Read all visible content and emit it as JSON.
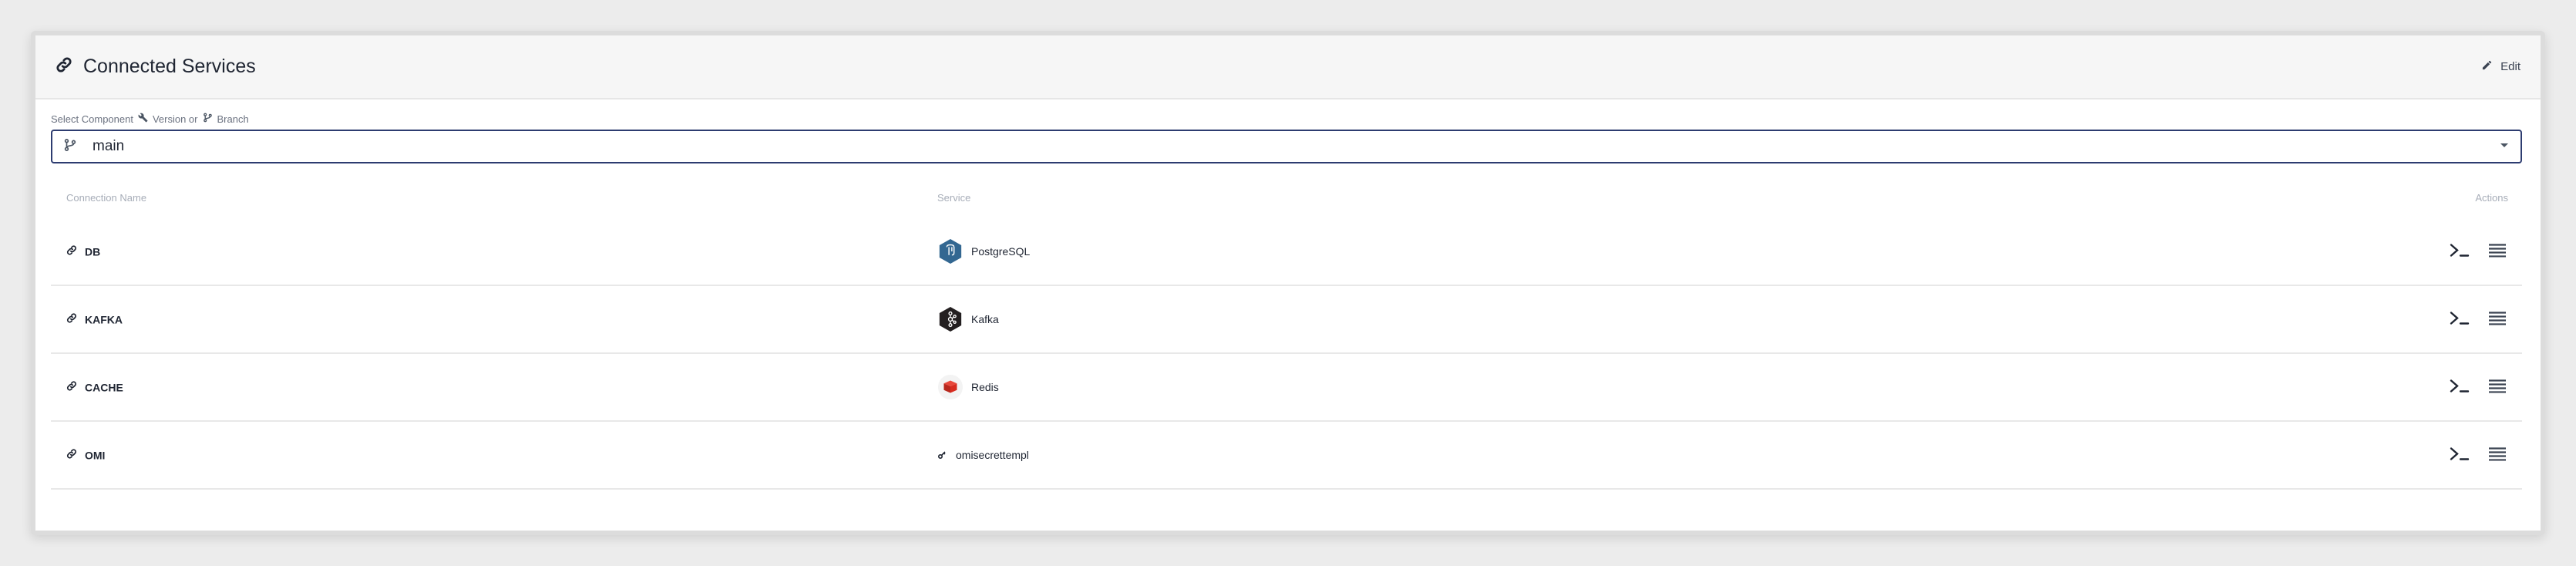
{
  "panel": {
    "title": "Connected Services",
    "edit_label": "Edit"
  },
  "selector": {
    "label_prefix": "Select Component",
    "label_version": "Version or",
    "label_branch": "Branch",
    "value": "main"
  },
  "table": {
    "headers": {
      "connection_name": "Connection Name",
      "service": "Service",
      "actions": "Actions"
    },
    "rows": [
      {
        "name": "DB",
        "service": "PostgreSQL",
        "service_icon": "postgresql-icon"
      },
      {
        "name": "KAFKA",
        "service": "Kafka",
        "service_icon": "kafka-icon"
      },
      {
        "name": "CACHE",
        "service": "Redis",
        "service_icon": "redis-icon"
      },
      {
        "name": "OMI",
        "service": "omisecrettempl",
        "service_icon": "secret-template-icon"
      }
    ]
  },
  "icons": {
    "title": "link-icon",
    "edit": "pencil-icon",
    "branch": "git-branch-icon",
    "dropdown": "caret-down-icon",
    "console": "terminal-icon",
    "menu": "hamburger-menu-icon"
  },
  "colors": {
    "select_border": "#2d3c70",
    "postgres": "#336791",
    "kafka": "#231f20",
    "redis": "#d82c20"
  }
}
